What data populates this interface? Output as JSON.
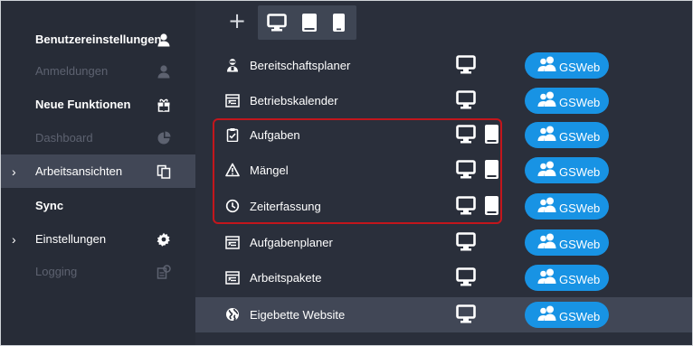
{
  "sidebar": {
    "items": [
      {
        "label": "Benutzereinstellungen",
        "icon": "user-icon",
        "state": "normal"
      },
      {
        "label": "Anmeldungen",
        "icon": "user-icon",
        "state": "disabled"
      },
      {
        "label": "Neue Funktionen",
        "icon": "gift-icon",
        "state": "normal"
      },
      {
        "label": "Dashboard",
        "icon": "pie-chart-icon",
        "state": "disabled"
      },
      {
        "label": "Arbeitsansichten",
        "icon": "copy-icon",
        "state": "active",
        "arrow": "›"
      },
      {
        "label": "Sync",
        "icon": "",
        "state": "normal"
      },
      {
        "label": "Einstellungen",
        "icon": "gear-icon",
        "state": "normal",
        "arrow": "›"
      },
      {
        "label": "Logging",
        "icon": "log-icon",
        "state": "disabled"
      }
    ]
  },
  "toolbar": {
    "add_label": "+",
    "devices": [
      "desktop-icon",
      "tablet-icon",
      "phone-icon"
    ]
  },
  "views": [
    {
      "label": "Bereitschaftsplaner",
      "icon": "person-icon",
      "desktop": true,
      "tablet": false,
      "badge": "GSWeb"
    },
    {
      "label": "Betriebskalender",
      "icon": "calendar-list-icon",
      "desktop": true,
      "tablet": false,
      "badge": "GSWeb"
    },
    {
      "label": "Aufgaben",
      "icon": "clipboard-check-icon",
      "desktop": true,
      "tablet": true,
      "badge": "GSWeb"
    },
    {
      "label": "Mängel",
      "icon": "warning-icon",
      "desktop": true,
      "tablet": true,
      "badge": "GSWeb"
    },
    {
      "label": "Zeiterfassung",
      "icon": "clock-icon",
      "desktop": true,
      "tablet": true,
      "badge": "GSWeb"
    },
    {
      "label": "Aufgabenplaner",
      "icon": "calendar-list-icon",
      "desktop": true,
      "tablet": false,
      "badge": "GSWeb"
    },
    {
      "label": "Arbeitspakete",
      "icon": "calendar-list-icon",
      "desktop": true,
      "tablet": false,
      "badge": "GSWeb"
    },
    {
      "label": "Eigebette Website",
      "icon": "globe-icon",
      "desktop": true,
      "tablet": false,
      "badge": "GSWeb",
      "active": true
    }
  ],
  "colors": {
    "sidebar_bg": "#272c37",
    "main_bg": "#2a2f3b",
    "active_bg": "#414756",
    "badge_bg": "#1893e4",
    "highlight": "#c3161c",
    "dim_text": "#5d6270"
  }
}
